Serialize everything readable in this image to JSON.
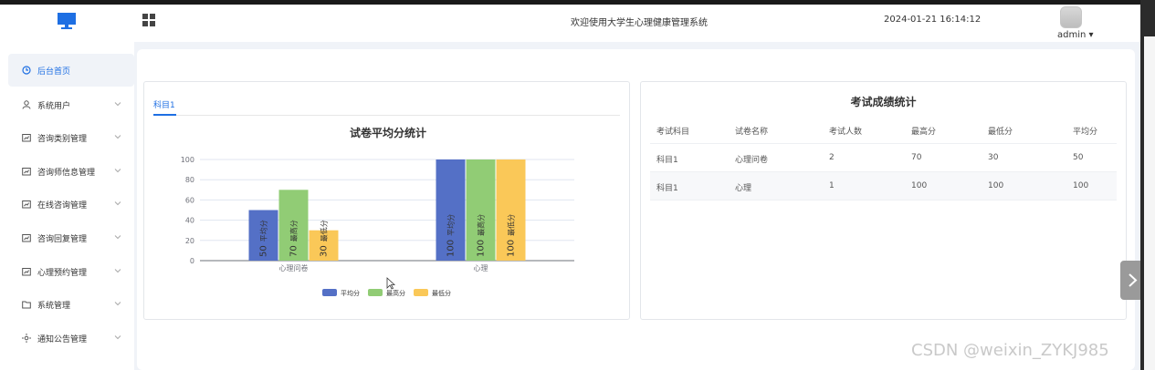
{
  "header": {
    "system_title": "欢迎使用大学生心理健康管理系统",
    "datetime": "2024-01-21 16:14:12",
    "user": "admin",
    "user_caret": "▾"
  },
  "sidebar": {
    "items": [
      {
        "label": "后台首页",
        "icon": "clock-icon",
        "active": true
      },
      {
        "label": "系统用户",
        "icon": "user-icon"
      },
      {
        "label": "咨询类别管理",
        "icon": "chart-icon"
      },
      {
        "label": "咨询师信息管理",
        "icon": "chart-icon"
      },
      {
        "label": "在线咨询管理",
        "icon": "chart-icon"
      },
      {
        "label": "咨询回复管理",
        "icon": "chart-icon"
      },
      {
        "label": "心理预约管理",
        "icon": "chart-icon"
      },
      {
        "label": "系统管理",
        "icon": "folder-icon"
      },
      {
        "label": "通知公告管理",
        "icon": "sun-icon"
      }
    ]
  },
  "left_card": {
    "tab": "科目1"
  },
  "chart_data": {
    "type": "bar",
    "title": "试卷平均分统计",
    "categories": [
      "心理问卷",
      "心理"
    ],
    "series": [
      {
        "name": "平均分",
        "values": [
          50,
          100
        ],
        "color": "#5470c6"
      },
      {
        "name": "最高分",
        "values": [
          70,
          100
        ],
        "color": "#91cc75"
      },
      {
        "name": "最低分",
        "values": [
          30,
          100
        ],
        "color": "#fac858"
      }
    ],
    "ylim": [
      0,
      100
    ],
    "yticks": [
      0,
      20,
      40,
      60,
      80,
      100
    ],
    "legend_position": "bottom",
    "grid": true
  },
  "right_card": {
    "title": "考试成绩统计",
    "columns": [
      "考试科目",
      "试卷名称",
      "考试人数",
      "最高分",
      "最低分",
      "平均分"
    ],
    "rows": [
      [
        "科目1",
        "心理问卷",
        "2",
        "70",
        "30",
        "50"
      ],
      [
        "科目1",
        "心理",
        "1",
        "100",
        "100",
        "100"
      ]
    ]
  },
  "watermark": "CSDN @weixin_ZYKJ985"
}
